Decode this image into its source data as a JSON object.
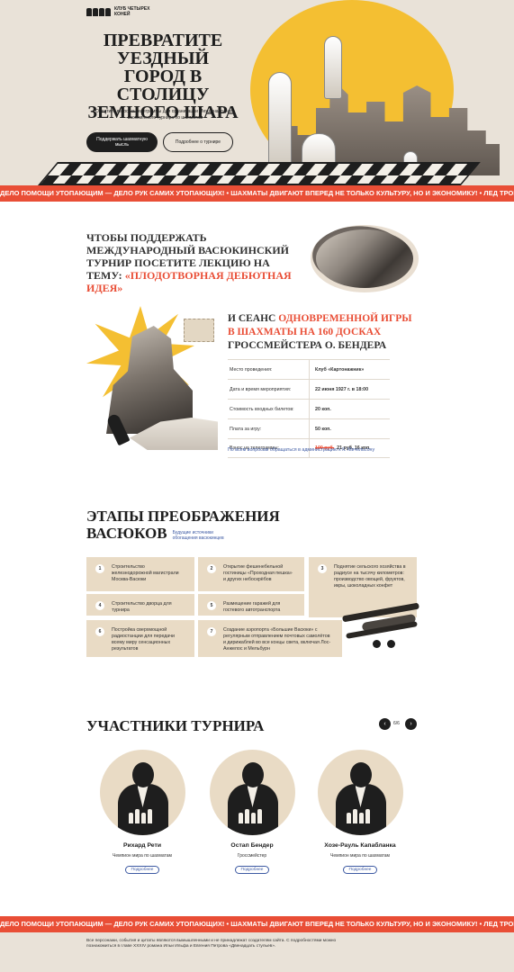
{
  "logo": {
    "text": "КЛУБ ЧЕТЫРЕХ КОНЕЙ"
  },
  "hero": {
    "title": "ПРЕВРАТИТЕ УЕЗДНЫЙ ГОРОД В СТОЛИЦУ ЗЕМНОГО ШАРА",
    "subtitle": "Оплатите взнос на телеграммы для организации Международного васюкинского турнира по шахматам",
    "primary_button": "Поддержать шахматную мысль",
    "secondary_button": "Подробнее о турнире"
  },
  "ticker": {
    "text": "ДЕЛО ПОМОЩИ УТОПАЮЩИМ — ДЕЛО РУК САМИХ УТОПАЮЩИХ! • ШАХМАТЫ ДВИГАЮТ ВПЕРЕД НЕ ТОЛЬКО КУЛЬТУРУ, НО И ЭКОНОМИКУ! • ЛЕД ТРОНУЛСЯ, ГОСПОДА ПРИСЯЖНЫЕ ЗАСЕДАТЕЛИ!"
  },
  "lecture": {
    "title_prefix": "ЧТОБЫ ПОДДЕРЖАТЬ МЕЖДУНАРОДНЫЙ ВАСЮКИНСКИЙ ТУРНИР ПОСЕТИТЕ ЛЕКЦИЮ НА ТЕМУ:",
    "title_highlight": "«ПЛОДОТВОРНАЯ ДЕБЮТНАЯ ИДЕЯ»"
  },
  "seance": {
    "title_prefix": "И СЕАНС",
    "title_highlight": "ОДНОВРЕМЕННОЙ ИГРЫ В ШАХМАТЫ НА 160 ДОСКАХ",
    "title_suffix": "ГРОССМЕЙСТЕРА О. БЕНДЕРА",
    "rows": [
      {
        "label": "Место проведения:",
        "value": "Клуб «Картонажник»"
      },
      {
        "label": "Дата и время мероприятия:",
        "value": "22 июня 1927 г. в 18:00"
      },
      {
        "label": "Стоимость входных билетов:",
        "value": "20 коп."
      },
      {
        "label": "Плата за игру:",
        "value": "50 коп."
      },
      {
        "label": "Взнос на телеграммы:",
        "value_old": "100 руб.",
        "value_new": "21 руб. 16 коп."
      }
    ],
    "contact_note": "По всем вопросам обращаться в администрацию к К. Мичельсону"
  },
  "stages": {
    "title_line1": "ЭТАПЫ ПРЕОБРАЖЕНИЯ",
    "title_line2": "ВАСЮКОВ",
    "note": "Будущие источники обогащения васюкинцев",
    "items": [
      {
        "num": "1",
        "text": "Строительство железнодорожной магистрали Москва-Васюки"
      },
      {
        "num": "2",
        "text": "Открытие фешенебельной гостиницы «Проходная пешка» и других небоскрёбов"
      },
      {
        "num": "3",
        "text": "Поднятие сельского хозяйства в радиусе на тысячу километров: производство овощей, фруктов, икры, шоколадных конфет"
      },
      {
        "num": "4",
        "text": "Строительство дворца для турнира"
      },
      {
        "num": "5",
        "text": "Размещение гаражей для гостевого автотранспорта"
      },
      {
        "num": "6",
        "text": "Постройка сверхмощной радиостанции для передачи всему миру сенсационных результатов"
      },
      {
        "num": "7",
        "text": "Создание аэропорта «Большие Васюки» с регулярным отправлением почтовых самолётов и дирижаблей во все концы света, включая Лос-Анжелос и Мельбурн"
      }
    ]
  },
  "participants": {
    "title": "УЧАСТНИКИ ТУРНИРА",
    "counter": "6/6",
    "prev_icon": "‹",
    "next_icon": "›",
    "cards": [
      {
        "name": "Рихард Рети",
        "role": "Чемпион мира по шахматам",
        "button": "Подробнее"
      },
      {
        "name": "Остап Бендер",
        "role": "Гроссмейстер",
        "button": "Подробнее"
      },
      {
        "name": "Хозе-Рауль Капабланка",
        "role": "Чемпион мира по шахматам",
        "button": "Подробнее"
      }
    ]
  },
  "footer": {
    "text": "Все персонажи, события и цитаты являются вымышленными и не принадлежат создателям сайта. С подробностями можно познакомиться в главе XXXIV романа Ильи Ильфа и Евгения Петрова «Двенадцать стульев»."
  },
  "colors": {
    "accent_red": "#e94e36",
    "accent_yellow": "#f4bf32",
    "beige": "#e9dbc5",
    "link_blue": "#3d5aa3",
    "dark": "#1e1e1e"
  }
}
